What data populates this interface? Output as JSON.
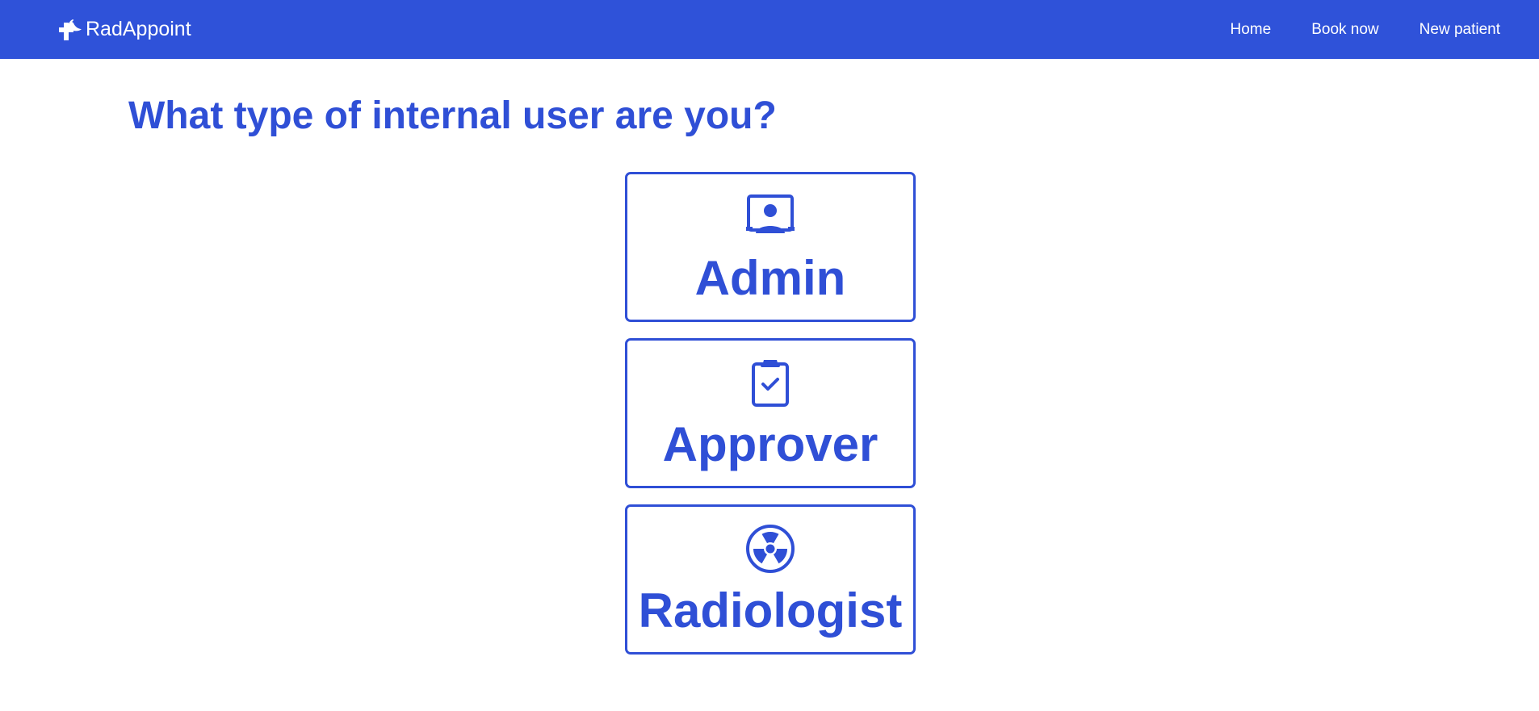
{
  "app": {
    "brand_name": "RadAppoint",
    "brand_icon": "medical-cross-bird-icon",
    "accent_color": "#2f52d9",
    "text_color": "#2f4fd6"
  },
  "nav": {
    "items": [
      {
        "label": "Home"
      },
      {
        "label": "Book now"
      },
      {
        "label": "New patient"
      }
    ]
  },
  "page": {
    "heading": "What type of internal user are you?"
  },
  "roles": [
    {
      "label": "Admin",
      "icon": "user-presentation-icon"
    },
    {
      "label": "Approver",
      "icon": "clipboard-check-icon"
    },
    {
      "label": "Radiologist",
      "icon": "radiation-icon"
    }
  ]
}
